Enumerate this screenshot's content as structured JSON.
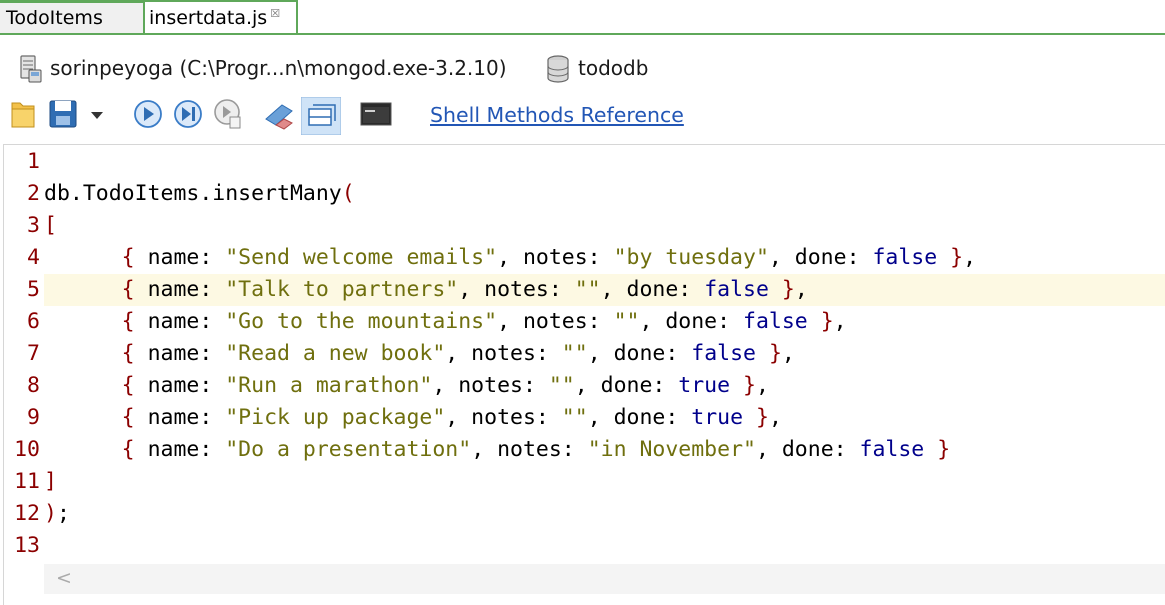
{
  "tabs": [
    {
      "label": "TodoItems",
      "active": false
    },
    {
      "label": "insertdata.js",
      "active": true,
      "close_glyph": "☒"
    }
  ],
  "connection": {
    "server_label": "sorinpeyoga (C:\\Progr...n\\mongod.exe-3.2.10)",
    "server_icon": "server-icon",
    "database_label": "tododb",
    "database_icon": "database-icon"
  },
  "toolbar": {
    "icons": [
      "open-folder-icon",
      "save-icon",
      "save-dropdown-icon",
      "run-icon",
      "run-line-icon",
      "step-icon",
      "format-icon",
      "result-mode-icon",
      "shell-icon"
    ],
    "shell_methods_link": "Shell Methods Reference"
  },
  "editor": {
    "current_line": 5,
    "line_numbers": [
      "1",
      "2",
      "3",
      "4",
      "5",
      "6",
      "7",
      "8",
      "9",
      "10",
      "11",
      "12",
      "13"
    ],
    "lines": [
      [],
      [
        {
          "t": "db.TodoItems.insertMany",
          "c": "p"
        },
        {
          "t": "(",
          "c": "k"
        }
      ],
      [
        {
          "t": "[",
          "c": "k"
        }
      ],
      [
        {
          "t": "      ",
          "c": "p"
        },
        {
          "t": "{",
          "c": "k"
        },
        {
          "t": " name: ",
          "c": "p"
        },
        {
          "t": "\"Send welcome emails\"",
          "c": "s"
        },
        {
          "t": ", notes: ",
          "c": "p"
        },
        {
          "t": "\"by tuesday\"",
          "c": "s"
        },
        {
          "t": ", done: ",
          "c": "p"
        },
        {
          "t": "false",
          "c": "b"
        },
        {
          "t": " ",
          "c": "p"
        },
        {
          "t": "}",
          "c": "k"
        },
        {
          "t": ",",
          "c": "p"
        }
      ],
      [
        {
          "t": "      ",
          "c": "p"
        },
        {
          "t": "{",
          "c": "k"
        },
        {
          "t": " name: ",
          "c": "p"
        },
        {
          "t": "\"Talk to partners\"",
          "c": "s"
        },
        {
          "t": ", notes: ",
          "c": "p"
        },
        {
          "t": "\"\"",
          "c": "s"
        },
        {
          "t": ", done: ",
          "c": "p"
        },
        {
          "t": "false",
          "c": "b"
        },
        {
          "t": " ",
          "c": "p"
        },
        {
          "t": "}",
          "c": "k"
        },
        {
          "t": ",",
          "c": "p"
        }
      ],
      [
        {
          "t": "      ",
          "c": "p"
        },
        {
          "t": "{",
          "c": "k"
        },
        {
          "t": " name: ",
          "c": "p"
        },
        {
          "t": "\"Go to the mountains\"",
          "c": "s"
        },
        {
          "t": ", notes: ",
          "c": "p"
        },
        {
          "t": "\"\"",
          "c": "s"
        },
        {
          "t": ", done: ",
          "c": "p"
        },
        {
          "t": "false",
          "c": "b"
        },
        {
          "t": " ",
          "c": "p"
        },
        {
          "t": "}",
          "c": "k"
        },
        {
          "t": ",",
          "c": "p"
        }
      ],
      [
        {
          "t": "      ",
          "c": "p"
        },
        {
          "t": "{",
          "c": "k"
        },
        {
          "t": " name: ",
          "c": "p"
        },
        {
          "t": "\"Read a new book\"",
          "c": "s"
        },
        {
          "t": ", notes: ",
          "c": "p"
        },
        {
          "t": "\"\"",
          "c": "s"
        },
        {
          "t": ", done: ",
          "c": "p"
        },
        {
          "t": "false",
          "c": "b"
        },
        {
          "t": " ",
          "c": "p"
        },
        {
          "t": "}",
          "c": "k"
        },
        {
          "t": ",",
          "c": "p"
        }
      ],
      [
        {
          "t": "      ",
          "c": "p"
        },
        {
          "t": "{",
          "c": "k"
        },
        {
          "t": " name: ",
          "c": "p"
        },
        {
          "t": "\"Run a marathon\"",
          "c": "s"
        },
        {
          "t": ", notes: ",
          "c": "p"
        },
        {
          "t": "\"\"",
          "c": "s"
        },
        {
          "t": ", done: ",
          "c": "p"
        },
        {
          "t": "true",
          "c": "b"
        },
        {
          "t": " ",
          "c": "p"
        },
        {
          "t": "}",
          "c": "k"
        },
        {
          "t": ",",
          "c": "p"
        }
      ],
      [
        {
          "t": "      ",
          "c": "p"
        },
        {
          "t": "{",
          "c": "k"
        },
        {
          "t": " name: ",
          "c": "p"
        },
        {
          "t": "\"Pick up package\"",
          "c": "s"
        },
        {
          "t": ", notes: ",
          "c": "p"
        },
        {
          "t": "\"\"",
          "c": "s"
        },
        {
          "t": ", done: ",
          "c": "p"
        },
        {
          "t": "true",
          "c": "b"
        },
        {
          "t": " ",
          "c": "p"
        },
        {
          "t": "}",
          "c": "k"
        },
        {
          "t": ",",
          "c": "p"
        }
      ],
      [
        {
          "t": "      ",
          "c": "p"
        },
        {
          "t": "{",
          "c": "k"
        },
        {
          "t": " name: ",
          "c": "p"
        },
        {
          "t": "\"Do a presentation\"",
          "c": "s"
        },
        {
          "t": ", notes: ",
          "c": "p"
        },
        {
          "t": "\"in November\"",
          "c": "s"
        },
        {
          "t": ", done: ",
          "c": "p"
        },
        {
          "t": "false",
          "c": "b"
        },
        {
          "t": " ",
          "c": "p"
        },
        {
          "t": "}",
          "c": "k"
        }
      ],
      [
        {
          "t": "]",
          "c": "k"
        }
      ],
      [
        {
          "t": ")",
          "c": "k"
        },
        {
          "t": ";",
          "c": "p"
        }
      ],
      []
    ]
  },
  "scrollbar": {
    "left_arrow": "<"
  },
  "colors": {
    "accent_green": "#5fa85a",
    "bracket": "#8b0000",
    "string": "#6f6f0e",
    "boolean": "#00008b",
    "link": "#2256b5",
    "current_line_bg": "#fdf9e3"
  }
}
